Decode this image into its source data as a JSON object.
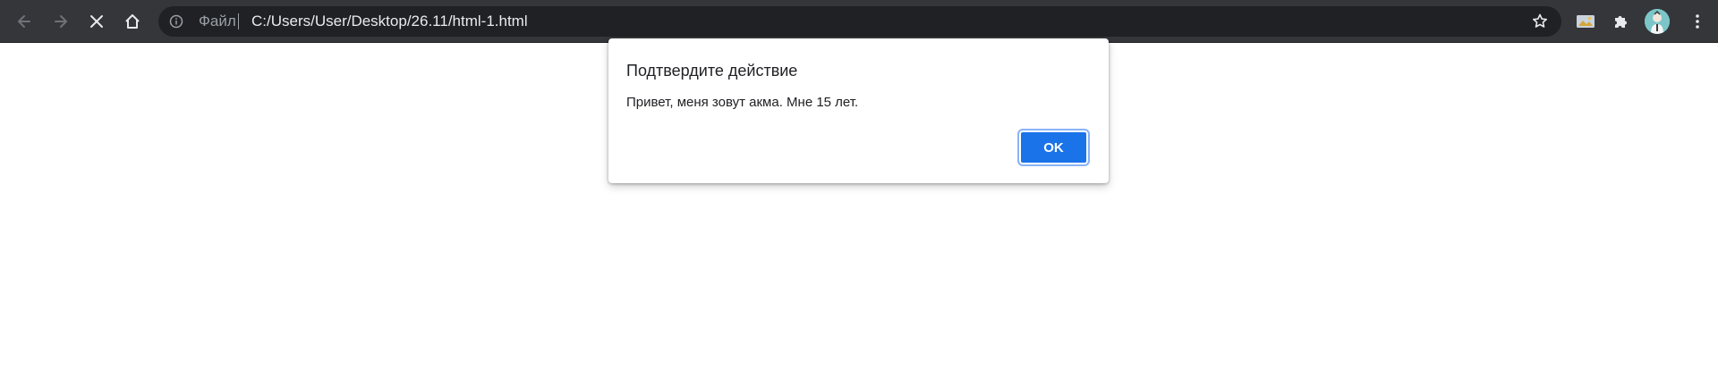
{
  "browser": {
    "nav": {
      "back_icon": "arrow-left-icon",
      "forward_icon": "arrow-right-icon",
      "stop_icon": "close-icon",
      "home_icon": "home-icon"
    },
    "omnibox": {
      "security_icon": "info-icon",
      "scheme_label": "Файл",
      "url": "C:/Users/User/Desktop/26.11/html-1.html",
      "bookmark_icon": "star-icon"
    },
    "extensions": {
      "media_icon": "image-icon",
      "extensions_icon": "puzzle-icon",
      "profile_icon": "avatar",
      "menu_icon": "more-vertical-icon"
    }
  },
  "dialog": {
    "title": "Подтвердите действие",
    "message": "Привет, меня зовут акма. Мне 15 лет.",
    "ok_label": "OK"
  },
  "colors": {
    "toolbar_bg": "#35363a",
    "omnibox_bg": "#202124",
    "accent": "#1a73e8",
    "page_bg": "#ffffff"
  }
}
